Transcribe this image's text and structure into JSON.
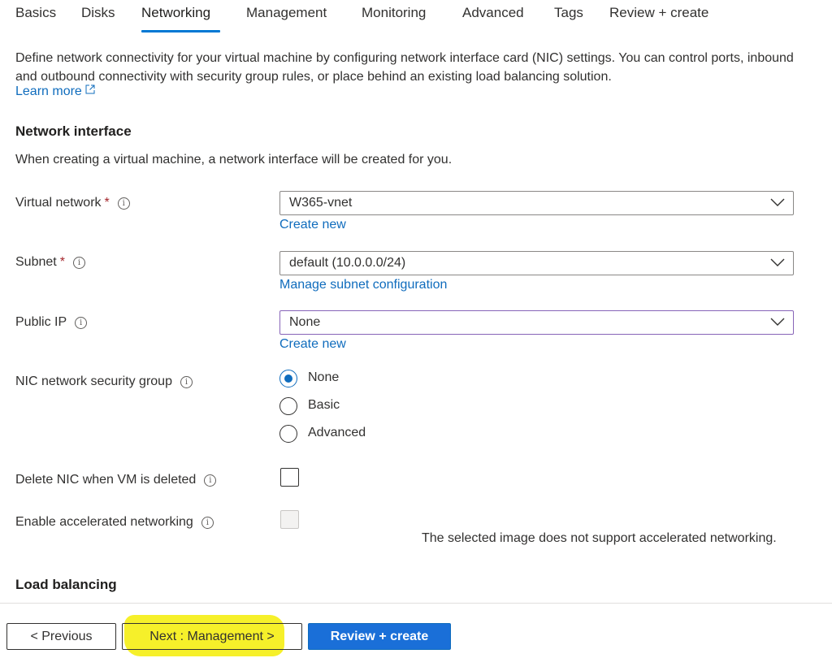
{
  "tabs": [
    {
      "label": "Basics"
    },
    {
      "label": "Disks"
    },
    {
      "label": "Networking"
    },
    {
      "label": "Management"
    },
    {
      "label": "Monitoring"
    },
    {
      "label": "Advanced"
    },
    {
      "label": "Tags"
    },
    {
      "label": "Review + create"
    }
  ],
  "active_tab": "Networking",
  "description": "Define network connectivity for your virtual machine by configuring network interface card (NIC) settings. You can control ports, inbound and outbound connectivity with security group rules, or place behind an existing load balancing solution.",
  "learn_more": "Learn more",
  "network_interface": {
    "heading": "Network interface",
    "subtext": "When creating a virtual machine, a network interface will be created for you.",
    "virtual_network": {
      "label": "Virtual network",
      "value": "W365-vnet",
      "link": "Create new"
    },
    "subnet": {
      "label": "Subnet",
      "value": "default (10.0.0.0/24)",
      "link": "Manage subnet configuration"
    },
    "public_ip": {
      "label": "Public IP",
      "value": "None",
      "link": "Create new"
    },
    "nsg": {
      "label": "NIC network security group",
      "options": [
        "None",
        "Basic",
        "Advanced"
      ],
      "selected": "None"
    },
    "delete_nic": {
      "label": "Delete NIC when VM is deleted",
      "checked": false
    },
    "accelerated": {
      "label": "Enable accelerated networking",
      "checked": false,
      "disabled": true,
      "note": "The selected image does not support accelerated networking."
    }
  },
  "load_balancing": {
    "heading": "Load balancing"
  },
  "footer": {
    "previous": "< Previous",
    "next": "Next : Management >",
    "review": "Review + create"
  },
  "colors": {
    "link": "#0f6cbd",
    "accent": "#0078d4",
    "primary_button": "#1a6fd8",
    "required": "#a4262c",
    "highlight": "#f6f02a"
  },
  "icons": {
    "info": "info-circle-icon",
    "chevron": "chevron-down-icon",
    "external": "external-link-icon"
  }
}
